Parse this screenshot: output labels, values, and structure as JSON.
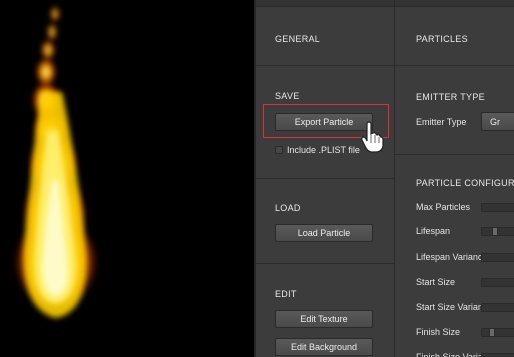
{
  "left_panel": {
    "general_title": "GENERAL",
    "save_title": "SAVE",
    "export_label": "Export Particle",
    "plist_label": "Include .PLIST file",
    "plist_checked": false,
    "load_title": "LOAD",
    "load_label": "Load Particle",
    "edit_title": "EDIT",
    "edit_texture_label": "Edit Texture",
    "edit_background_label": "Edit Background"
  },
  "right_panel": {
    "particles_title": "PARTICLES",
    "emitter_type_title": "EMITTER TYPE",
    "emitter_type_label": "Emitter Type",
    "emitter_type_value": "Gr",
    "config_title": "PARTICLE CONFIGURATI",
    "properties": [
      {
        "label": "Max Particles",
        "value": 0.0
      },
      {
        "label": "Lifespan",
        "value": 0.08
      },
      {
        "label": "Lifespan Variance",
        "value": 0.0
      },
      {
        "label": "Start Size",
        "value": 0.0
      },
      {
        "label": "Start Size Variance",
        "value": 0.0
      },
      {
        "label": "Finish Size",
        "value": 0.06
      },
      {
        "label": "Finish Size Variance",
        "value": 0.0
      }
    ]
  },
  "colors": {
    "highlight": "#e03030",
    "flame_core": "#fff8a0",
    "flame_mid": "#ffb000",
    "flame_edge": "#ff5a00"
  },
  "icons": {
    "cursor": "hand-pointer-icon",
    "preview": "flame-particle-preview"
  }
}
